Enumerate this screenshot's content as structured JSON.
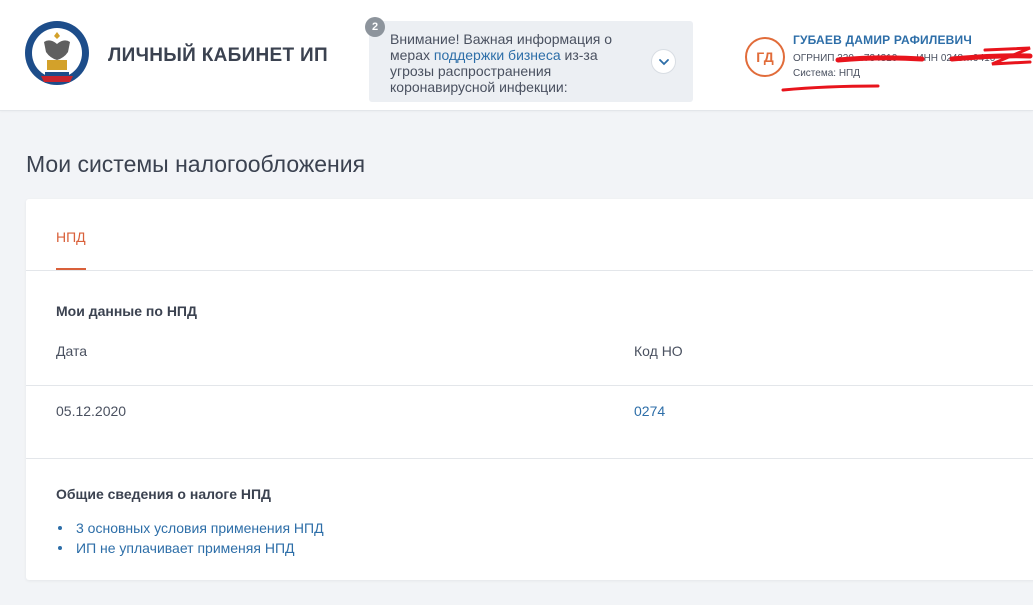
{
  "header": {
    "brand_title": "ЛИЧНЫЙ КАБИНЕТ ИП",
    "notice": {
      "badge_count": "2",
      "text_before": "Внимание! Важная информация о мерах ",
      "link_text": "поддержки бизнеса",
      "text_after": " из-за угрозы распространения коронавирусной инфекции:"
    },
    "user": {
      "initials": "ГД",
      "name": "ГУБАЕВ ДАМИР РАФИЛЕВИЧ",
      "ogrnip_label": "ОГРНИП",
      "ogrnip_value": "320…734310",
      "inn_label": "ИНН",
      "inn_value": "0248…9410",
      "system_label": "Система: НПД"
    }
  },
  "page": {
    "title": "Мои системы налогообложения"
  },
  "card": {
    "tab_label": "НПД",
    "data_section_title": "Мои данные по НПД",
    "columns": [
      "Дата",
      "Код НО"
    ],
    "row": {
      "date": "05.12.2020",
      "code": "0274"
    },
    "general_title": "Общие сведения о налоге НПД",
    "links": [
      "3 основных условия применения НПД",
      "ИП не уплачивает применяя НПД"
    ]
  },
  "colors": {
    "accent_orange": "#d9603a",
    "link_blue": "#2d6ea8",
    "background": "#f2f4f7"
  }
}
